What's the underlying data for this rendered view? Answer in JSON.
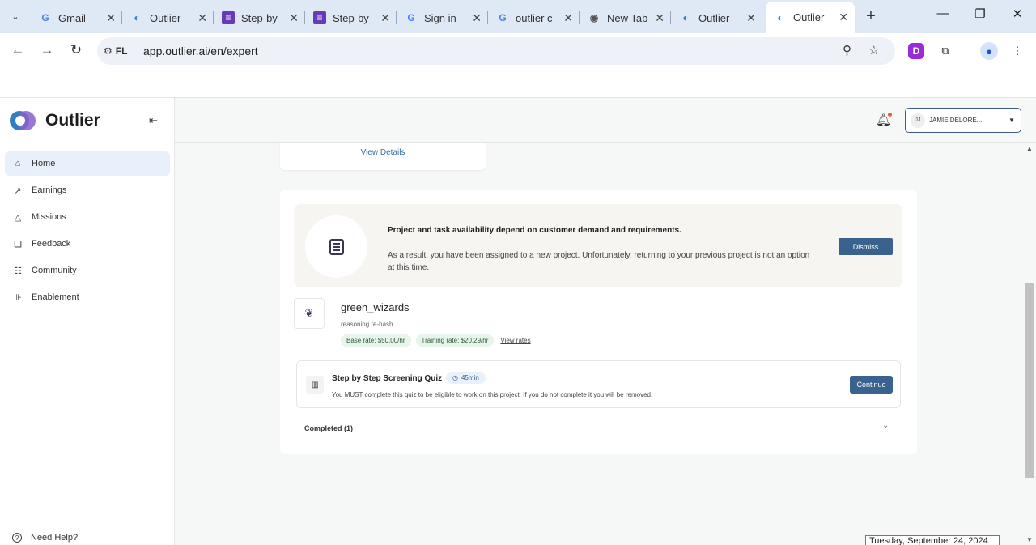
{
  "browser": {
    "tabs": [
      {
        "title": "Gmail",
        "favicon": "G"
      },
      {
        "title": "Outlier",
        "favicon": "outlier"
      },
      {
        "title": "Step-by",
        "favicon": "forms"
      },
      {
        "title": "Step-by",
        "favicon": "forms"
      },
      {
        "title": "Sign in",
        "favicon": "G"
      },
      {
        "title": "outlier c",
        "favicon": "G"
      },
      {
        "title": "New Tab",
        "favicon": "chrome"
      },
      {
        "title": "Outlier",
        "favicon": "outlier"
      },
      {
        "title": "Outlier",
        "favicon": "outlier"
      }
    ],
    "site_badge": "FL",
    "url": "app.outlier.ai/en/expert",
    "profile_initial": "D"
  },
  "sidebar": {
    "brand": "Outlier",
    "items": [
      {
        "label": "Home",
        "icon": "home-icon"
      },
      {
        "label": "Earnings",
        "icon": "chart-icon"
      },
      {
        "label": "Missions",
        "icon": "triangle-icon"
      },
      {
        "label": "Feedback",
        "icon": "chat-icon"
      },
      {
        "label": "Community",
        "icon": "people-icon"
      },
      {
        "label": "Enablement",
        "icon": "dumbbell-icon"
      }
    ],
    "help_label": "Need Help?"
  },
  "topbar": {
    "user_initials": "JJ",
    "user_name": "JAMIE DELORE..."
  },
  "main": {
    "view_details": "View Details",
    "notice": {
      "title": "Project and task availability depend on customer demand and requirements.",
      "body": "As a result, you have been assigned to a new project. Unfortunately, returning to your previous project is not an option at this time.",
      "dismiss": "Dismiss"
    },
    "project": {
      "name": "green_wizards",
      "subtitle": "reasoning re-hash",
      "base_rate": "Base rate: $50.00/hr",
      "training_rate": "Training rate: $20.29/hr",
      "view_rates": "View rates"
    },
    "quiz": {
      "title": "Step by Step Screening Quiz",
      "time": "45min",
      "description": "You MUST complete this quiz to be eligible to work on this project. If you do not complete it you will be removed.",
      "continue": "Continue"
    },
    "completed": "Completed (1)"
  },
  "overlay_date": "Tuesday, September 24, 2024"
}
